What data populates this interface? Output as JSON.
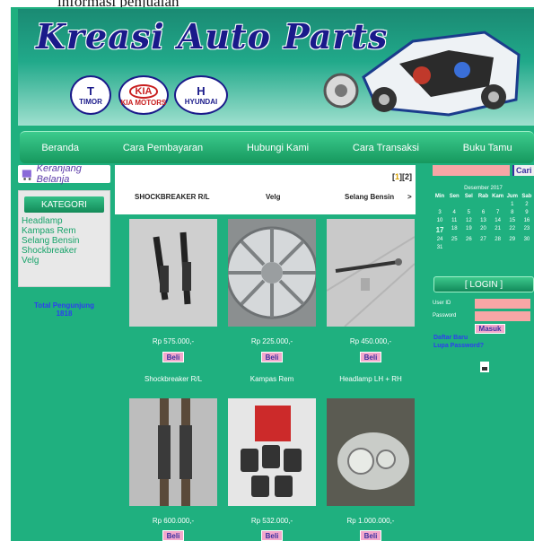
{
  "page": {
    "caption": "informasi penjualan"
  },
  "header": {
    "logo_text": "Kreasi Auto Parts",
    "brands": [
      {
        "name": "TIMOR",
        "glyph": "T"
      },
      {
        "name": "KIA MOTORS",
        "glyph": "KIA"
      },
      {
        "name": "HYUNDAI",
        "glyph": "H"
      }
    ]
  },
  "nav": [
    "Beranda",
    "Cara Pembayaran",
    "Hubungi Kami",
    "Cara Transaksi",
    "Buku Tamu"
  ],
  "sidebar": {
    "cart_label": "Keranjang Belanja",
    "category_title": "KATEGORI",
    "categories": [
      "Headlamp",
      "Kampas Rem",
      "Selang Bensin",
      "Shockbreaker",
      "Velg"
    ],
    "visitors_label": "Total Pengunjung",
    "visitors_count": "1818"
  },
  "main": {
    "pager": {
      "open": "[",
      "page1": "1",
      "mid": "][",
      "page2": "2",
      "close": "]"
    },
    "ticker": [
      "SHOCKBREAKER R/L",
      "Velg",
      "Selang Bensin",
      ">"
    ],
    "buy_label": "Beli",
    "products": [
      {
        "name": "",
        "price": "Rp 575.000,-"
      },
      {
        "name": "",
        "price": "Rp 225.000,-"
      },
      {
        "name": "",
        "price": "Rp 450.000,-"
      },
      {
        "name": "Shockbreaker R/L",
        "price": "Rp 600.000,-"
      },
      {
        "name": "Kampas Rem",
        "price": "Rp 532.000,-"
      },
      {
        "name": "Headlamp LH + RH",
        "price": "Rp 1.000.000,-"
      }
    ]
  },
  "search": {
    "button": "Cari",
    "value": ""
  },
  "calendar": {
    "title": "Desember 2017",
    "days": [
      "Min",
      "Sen",
      "Sel",
      "Rab",
      "Kam",
      "Jum",
      "Sab"
    ],
    "weeks": [
      [
        "",
        "",
        "",
        "",
        "",
        "1",
        "2"
      ],
      [
        "3",
        "4",
        "5",
        "6",
        "7",
        "8",
        "9"
      ],
      [
        "10",
        "11",
        "12",
        "13",
        "14",
        "15",
        "16"
      ],
      [
        "17",
        "18",
        "19",
        "20",
        "21",
        "22",
        "23"
      ],
      [
        "24",
        "25",
        "26",
        "27",
        "28",
        "29",
        "30"
      ],
      [
        "31",
        "",
        "",
        "",
        "",
        "",
        ""
      ]
    ],
    "today": "17"
  },
  "login": {
    "title": "[ LOGIN ]",
    "user_label": "User ID",
    "pass_label": "Password",
    "submit": "Masuk",
    "register": "Daftar Baru",
    "forgot": "Lupa Password?"
  },
  "colors": {
    "site_bg": "#1fb07f",
    "accent_pink": "#f3a8cc",
    "link_blue": "#2f3df0"
  }
}
